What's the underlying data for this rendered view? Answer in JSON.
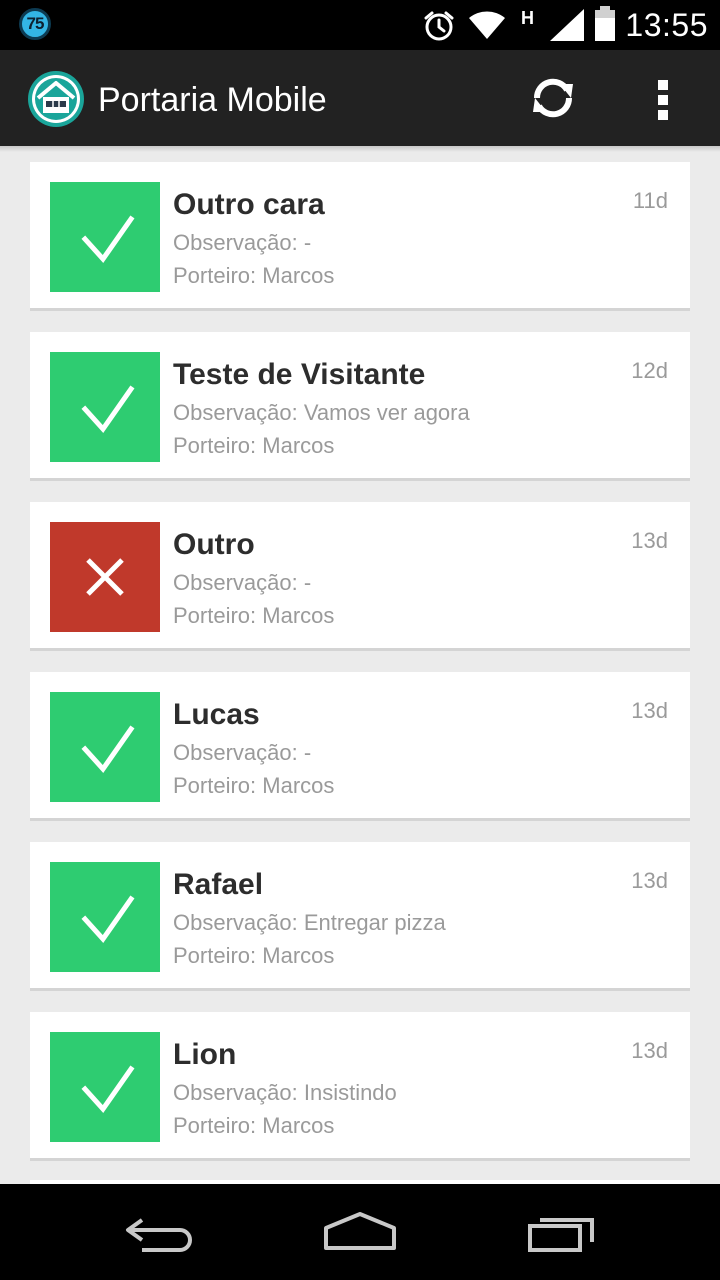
{
  "status_bar": {
    "badge": "75",
    "network_label": "H",
    "time": "13:55"
  },
  "action_bar": {
    "title": "Portaria Mobile",
    "icons": [
      "app-home-icon",
      "refresh-icon",
      "overflow-menu-icon"
    ]
  },
  "colors": {
    "approved": "#2ecc71",
    "denied": "#c0392b",
    "action_bar": "#222222"
  },
  "visits": [
    {
      "name": "Outro cara",
      "observation": "Observação: -",
      "porteiro": "Porteiro: Marcos",
      "age": "11d",
      "status": "approved"
    },
    {
      "name": "Teste de Visitante",
      "observation": "Observação: Vamos ver agora",
      "porteiro": "Porteiro: Marcos",
      "age": "12d",
      "status": "approved"
    },
    {
      "name": "Outro",
      "observation": "Observação: -",
      "porteiro": "Porteiro: Marcos",
      "age": "13d",
      "status": "denied"
    },
    {
      "name": "Lucas",
      "observation": "Observação: -",
      "porteiro": "Porteiro: Marcos",
      "age": "13d",
      "status": "approved"
    },
    {
      "name": "Rafael",
      "observation": "Observação: Entregar pizza",
      "porteiro": "Porteiro: Marcos",
      "age": "13d",
      "status": "approved"
    },
    {
      "name": "Lion",
      "observation": "Observação: Insistindo",
      "porteiro": "Porteiro: Marcos",
      "age": "13d",
      "status": "approved"
    }
  ],
  "nav_bar": {
    "icons": [
      "back-icon",
      "home-icon",
      "recent-apps-icon"
    ]
  }
}
